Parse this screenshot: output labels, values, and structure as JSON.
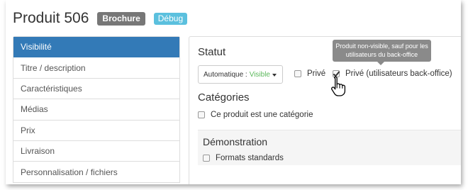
{
  "header": {
    "title": "Produit 506",
    "badge_primary": "Brochure",
    "badge_secondary": "Débug"
  },
  "sidebar": {
    "items": [
      {
        "label": "Visibilité",
        "active": true
      },
      {
        "label": "Titre / description",
        "active": false
      },
      {
        "label": "Caractéristiques",
        "active": false
      },
      {
        "label": "Médias",
        "active": false
      },
      {
        "label": "Prix",
        "active": false
      },
      {
        "label": "Livraison",
        "active": false
      },
      {
        "label": "Personnalisation / fichiers",
        "active": false
      }
    ]
  },
  "statut": {
    "title": "Statut",
    "select_label": "Automatique :",
    "select_value": "Visible",
    "prive_label": "Privé",
    "prive_checked": false,
    "prive_bo_label": "Privé (utilisateurs back-office)",
    "prive_bo_checked": true
  },
  "tooltip": {
    "line1": "Produit non-visible, sauf pour les",
    "line2": "utilisateurs du back-office"
  },
  "categories": {
    "title": "Catégories",
    "checkbox_label": "Ce produit est une catégorie",
    "checked": false
  },
  "demo": {
    "title": "Démonstration",
    "checkbox_label": "Formats standards",
    "checked": false
  },
  "colors": {
    "active": "#337ab7",
    "visible_status": "#5cb85c",
    "badge_dark": "#777777",
    "badge_info": "#5bc0de",
    "tooltip": "#8a8a8a"
  },
  "icons": {
    "cursor": "hand-pointer-icon",
    "dropdown": "caret-down-icon",
    "check": "checkmark-icon"
  }
}
